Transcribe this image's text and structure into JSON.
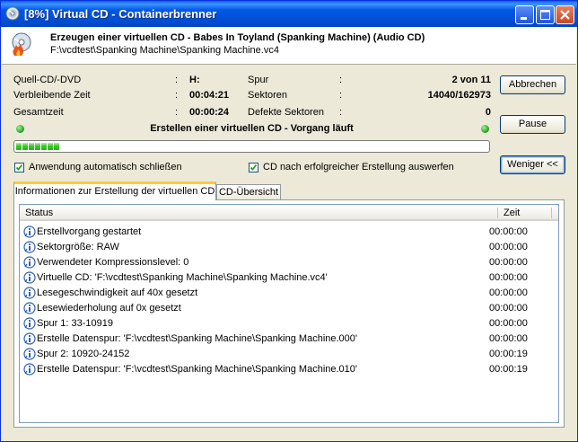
{
  "window": {
    "title": "[8%] Virtual CD - Containerbrenner"
  },
  "header": {
    "title": "Erzeugen einer virtuellen CD - Babes In Toyland (Spanking Machine) (Audio CD)",
    "path": "F:\\vcdtest\\Spanking Machine\\Spanking Machine.vc4"
  },
  "info": {
    "source_label": "Quell-CD/-DVD",
    "source_value": "H:",
    "remaining_label": "Verbleibende Zeit",
    "remaining_value": "00:04:21",
    "total_label": "Gesamtzeit",
    "total_value": "00:00:24",
    "track_label": "Spur",
    "track_value": "2 von 11",
    "sectors_label": "Sektoren",
    "sectors_value": "14040/162973",
    "bad_label": "Defekte Sektoren",
    "bad_value": "0",
    "colon": ":"
  },
  "status_text": "Erstellen einer virtuellen CD - Vorgang läuft",
  "progress": {
    "percent": 8,
    "segments": 7
  },
  "options": {
    "auto_close": "Anwendung automatisch schließen",
    "eject": "CD nach erfolgreicher Erstellung auswerfen",
    "auto_close_checked": true,
    "eject_checked": true
  },
  "buttons": {
    "cancel": "Abbrechen",
    "pause": "Pause",
    "less": "Weniger <<"
  },
  "tabs": [
    "Informationen zur Erstellung der virtuellen CD",
    "CD-Übersicht"
  ],
  "log": {
    "columns": [
      "Status",
      "Zeit"
    ],
    "rows": [
      {
        "msg": "Erstellvorgang gestartet",
        "time": "00:00:00"
      },
      {
        "msg": "Sektorgröße: RAW",
        "time": "00:00:00"
      },
      {
        "msg": "Verwendeter Kompressionslevel: 0",
        "time": "00:00:00"
      },
      {
        "msg": "Virtuelle CD: 'F:\\vcdtest\\Spanking Machine\\Spanking Machine.vc4'",
        "time": "00:00:00"
      },
      {
        "msg": "Lesegeschwindigkeit auf 40x gesetzt",
        "time": "00:00:00"
      },
      {
        "msg": "Lesewiederholung auf 0x gesetzt",
        "time": "00:00:00"
      },
      {
        "msg": "Spur 1: 33-10919",
        "time": "00:00:00"
      },
      {
        "msg": "Erstelle Datenspur: 'F:\\vcdtest\\Spanking Machine\\Spanking Machine.000'",
        "time": "00:00:00"
      },
      {
        "msg": "Spur 2: 10920-24152",
        "time": "00:00:19"
      },
      {
        "msg": "Erstelle Datenspur: 'F:\\vcdtest\\Spanking Machine\\Spanking Machine.010'",
        "time": "00:00:19"
      }
    ]
  },
  "icons": {
    "row": "info-icon",
    "app": "cd-icon",
    "header": "burn-cd-icon"
  },
  "colors": {
    "accent": "#0054e3",
    "progress": "#37c924",
    "tab_highlight": "#ffc83c"
  }
}
